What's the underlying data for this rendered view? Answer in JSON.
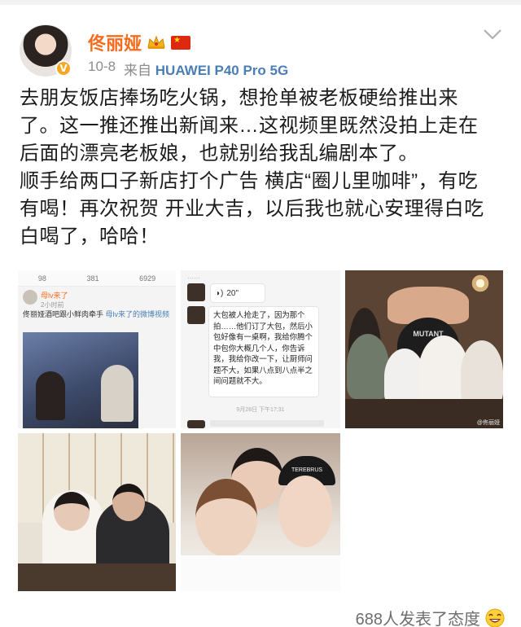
{
  "post": {
    "author": "佟丽娅",
    "date": "10-8",
    "source_prefix": "来自",
    "device": "HUAWEI P40 Pro 5G",
    "text_lines": [
      "去朋友饭店捧场吃火锅，想抢单被老板硬给推出来",
      "了。这一推还推出新闻来…这视频里既然没拍上走在",
      "后面的漂亮老板娘，也就别给我乱编剧本了。",
      "顺手给两口子新店打个广告 横店“圈儿里咖啡”，有吃",
      "有喝！再次祝贺 开业大吉，以后我也就心安理得白吃",
      "白喝了，哈哈！"
    ]
  },
  "images": {
    "img1": {
      "stats": [
        "98",
        "381",
        "6929"
      ],
      "user": "母lv来了",
      "time": "2小时前",
      "caption_a": "佟丽娅酒吧跟小鲜肉牵手",
      "caption_b": "母lv来了的微博视频"
    },
    "img2": {
      "header": "……",
      "voice": "20\"",
      "message": "大包被人抢走了，因为那个拍……他们订了大包，然后小包好像有一桌啊，我给你腾个中包你大概几个人，你告诉我，我给你改一下，让厨师问题不大，如果八点到八点半之间问题就不大。",
      "timestamp": "9月28日 下午17:31"
    },
    "img3": {
      "shirt_text": "MUTANT",
      "watermark": "@佟丽娅"
    },
    "img5": {
      "cap_text": "TEREBRUS"
    }
  },
  "footer": {
    "reactions": "688人发表了态度"
  },
  "colors": {
    "author": "#f76b1c",
    "device": "#4a7fb5",
    "meta": "#8c8c8c",
    "body_text": "#1c1c1c"
  },
  "icons": [
    "verified-badge-icon",
    "crown-icon",
    "china-flag-icon",
    "chevron-down-icon",
    "laughing-emoji-icon"
  ]
}
